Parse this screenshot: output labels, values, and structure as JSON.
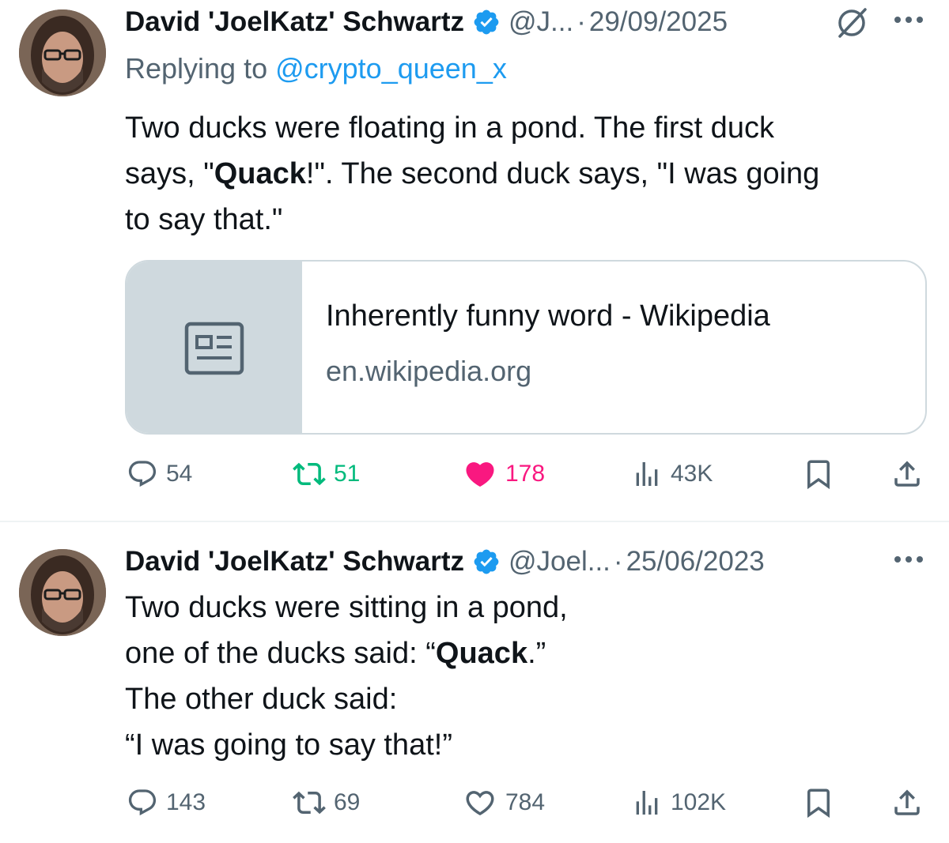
{
  "colors": {
    "accent": "#1d9bf0",
    "muted": "#536471",
    "text": "#0f1419",
    "retweet_active": "#00ba7c",
    "like_active": "#f91880",
    "border": "#cfd9de"
  },
  "tweets": [
    {
      "author_name": "David 'JoelKatz' Schwartz",
      "handle": "@J...",
      "separator": "·",
      "date": "29/09/2025",
      "reply_prefix": "Replying to",
      "reply_mention": "@crypto_queen_x",
      "body": {
        "line1": "Two ducks were floating in a pond. The first duck",
        "line2_pre": "says, \"",
        "line2_bold": "Quack",
        "line2_post": "!\". The second duck says, \"I was going",
        "line3": "to say that.\""
      },
      "link_card": {
        "icon": "article-icon",
        "title": "Inherently funny word - Wikipedia",
        "domain": "en.wikipedia.org"
      },
      "actions": {
        "replies": "54",
        "retweets": "51",
        "likes": "178",
        "views": "43K",
        "retweeted": true,
        "liked": true
      },
      "icons": [
        "verified-badge-icon",
        "grok-icon",
        "more-icon",
        "reply-icon",
        "retweet-icon",
        "like-icon",
        "views-icon",
        "bookmark-icon",
        "share-icon"
      ]
    },
    {
      "author_name": "David 'JoelKatz' Schwartz",
      "handle": "@Joel...",
      "separator": "·",
      "date": "25/06/2023",
      "body": {
        "line1": "Two ducks were sitting in a pond,",
        "line2_pre": "one of the ducks said: “",
        "line2_bold": "Quack",
        "line2_post": ".”",
        "line3": "The other duck said:",
        "line4": "“I was going to say that!”"
      },
      "actions": {
        "replies": "143",
        "retweets": "69",
        "likes": "784",
        "views": "102K",
        "retweeted": false,
        "liked": false
      },
      "icons": [
        "verified-badge-icon",
        "more-icon",
        "reply-icon",
        "retweet-icon",
        "like-icon",
        "views-icon",
        "bookmark-icon",
        "share-icon"
      ]
    }
  ]
}
